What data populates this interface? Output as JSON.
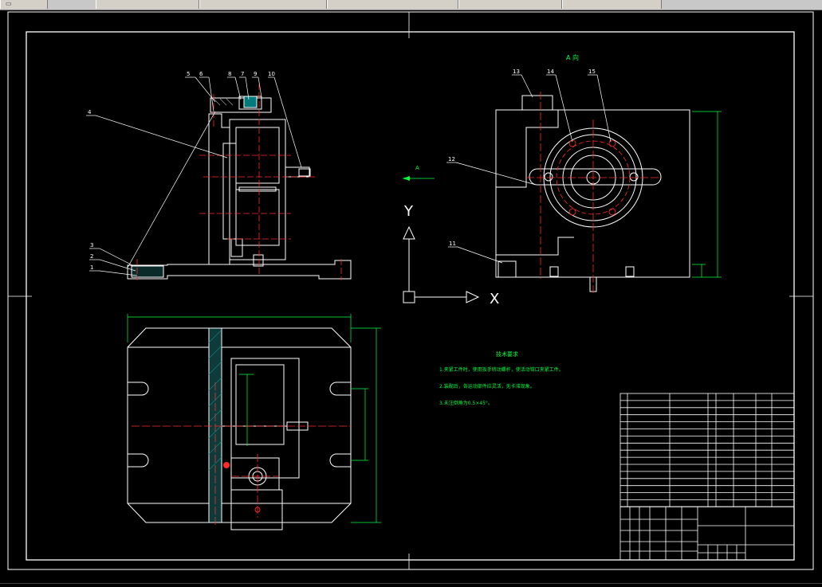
{
  "tabs": [
    {
      "label": "",
      "active": true
    },
    {
      "label": "",
      "active": false
    },
    {
      "label": "",
      "active": false
    },
    {
      "label": "",
      "active": false
    },
    {
      "label": "",
      "active": false
    },
    {
      "label": "",
      "active": false
    }
  ],
  "drawing": {
    "view_label": "A 向",
    "arrow_label": "A",
    "ucs": {
      "x_label": "X",
      "y_label": "Y"
    },
    "part_numbers": [
      "5",
      "6",
      "8",
      "7",
      "9",
      "10",
      "4",
      "3",
      "2",
      "1",
      "13",
      "14",
      "15",
      "12",
      "11"
    ],
    "notes_title": "技术要求",
    "notes": [
      "1.夹紧工件时，使用扳手转动螺杆，使活动钳口夹紧工件。",
      "2.装配后，各运动部件应灵活，无卡滞现象。",
      "3.未注倒角为0.5×45°。"
    ]
  },
  "colors": {
    "white": "#ffffff",
    "red": "#ff2a2a",
    "green": "#00ff3a",
    "cyan": "#00e0ff",
    "yellow": "#ffff00"
  }
}
